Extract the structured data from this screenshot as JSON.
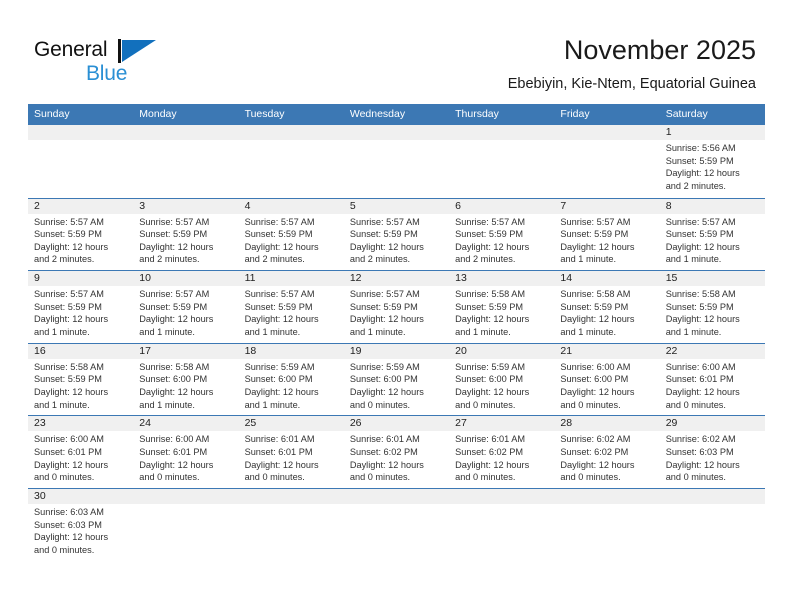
{
  "brand": {
    "name_top": "General",
    "name_bottom": "Blue",
    "primary_color": "#2a8fd4",
    "triangle_color": "#1270bd"
  },
  "header": {
    "title": "November 2025",
    "subtitle": "Ebebiyin, Kie-Ntem, Equatorial Guinea"
  },
  "theme": {
    "header_bar_color": "#3c78b4",
    "date_band_color": "#f0f0f0",
    "row_divider_color": "#3c78b4"
  },
  "calendar": {
    "weekdays": [
      "Sunday",
      "Monday",
      "Tuesday",
      "Wednesday",
      "Thursday",
      "Friday",
      "Saturday"
    ],
    "weeks": [
      [
        {
          "day": "",
          "lines": [
            "",
            "",
            "",
            ""
          ]
        },
        {
          "day": "",
          "lines": [
            "",
            "",
            "",
            ""
          ]
        },
        {
          "day": "",
          "lines": [
            "",
            "",
            "",
            ""
          ]
        },
        {
          "day": "",
          "lines": [
            "",
            "",
            "",
            ""
          ]
        },
        {
          "day": "",
          "lines": [
            "",
            "",
            "",
            ""
          ]
        },
        {
          "day": "",
          "lines": [
            "",
            "",
            "",
            ""
          ]
        },
        {
          "day": "1",
          "lines": [
            "Sunrise: 5:56 AM",
            "Sunset: 5:59 PM",
            "Daylight: 12 hours",
            "and 2 minutes."
          ]
        }
      ],
      [
        {
          "day": "2",
          "lines": [
            "Sunrise: 5:57 AM",
            "Sunset: 5:59 PM",
            "Daylight: 12 hours",
            "and 2 minutes."
          ]
        },
        {
          "day": "3",
          "lines": [
            "Sunrise: 5:57 AM",
            "Sunset: 5:59 PM",
            "Daylight: 12 hours",
            "and 2 minutes."
          ]
        },
        {
          "day": "4",
          "lines": [
            "Sunrise: 5:57 AM",
            "Sunset: 5:59 PM",
            "Daylight: 12 hours",
            "and 2 minutes."
          ]
        },
        {
          "day": "5",
          "lines": [
            "Sunrise: 5:57 AM",
            "Sunset: 5:59 PM",
            "Daylight: 12 hours",
            "and 2 minutes."
          ]
        },
        {
          "day": "6",
          "lines": [
            "Sunrise: 5:57 AM",
            "Sunset: 5:59 PM",
            "Daylight: 12 hours",
            "and 2 minutes."
          ]
        },
        {
          "day": "7",
          "lines": [
            "Sunrise: 5:57 AM",
            "Sunset: 5:59 PM",
            "Daylight: 12 hours",
            "and 1 minute."
          ]
        },
        {
          "day": "8",
          "lines": [
            "Sunrise: 5:57 AM",
            "Sunset: 5:59 PM",
            "Daylight: 12 hours",
            "and 1 minute."
          ]
        }
      ],
      [
        {
          "day": "9",
          "lines": [
            "Sunrise: 5:57 AM",
            "Sunset: 5:59 PM",
            "Daylight: 12 hours",
            "and 1 minute."
          ]
        },
        {
          "day": "10",
          "lines": [
            "Sunrise: 5:57 AM",
            "Sunset: 5:59 PM",
            "Daylight: 12 hours",
            "and 1 minute."
          ]
        },
        {
          "day": "11",
          "lines": [
            "Sunrise: 5:57 AM",
            "Sunset: 5:59 PM",
            "Daylight: 12 hours",
            "and 1 minute."
          ]
        },
        {
          "day": "12",
          "lines": [
            "Sunrise: 5:57 AM",
            "Sunset: 5:59 PM",
            "Daylight: 12 hours",
            "and 1 minute."
          ]
        },
        {
          "day": "13",
          "lines": [
            "Sunrise: 5:58 AM",
            "Sunset: 5:59 PM",
            "Daylight: 12 hours",
            "and 1 minute."
          ]
        },
        {
          "day": "14",
          "lines": [
            "Sunrise: 5:58 AM",
            "Sunset: 5:59 PM",
            "Daylight: 12 hours",
            "and 1 minute."
          ]
        },
        {
          "day": "15",
          "lines": [
            "Sunrise: 5:58 AM",
            "Sunset: 5:59 PM",
            "Daylight: 12 hours",
            "and 1 minute."
          ]
        }
      ],
      [
        {
          "day": "16",
          "lines": [
            "Sunrise: 5:58 AM",
            "Sunset: 5:59 PM",
            "Daylight: 12 hours",
            "and 1 minute."
          ]
        },
        {
          "day": "17",
          "lines": [
            "Sunrise: 5:58 AM",
            "Sunset: 6:00 PM",
            "Daylight: 12 hours",
            "and 1 minute."
          ]
        },
        {
          "day": "18",
          "lines": [
            "Sunrise: 5:59 AM",
            "Sunset: 6:00 PM",
            "Daylight: 12 hours",
            "and 1 minute."
          ]
        },
        {
          "day": "19",
          "lines": [
            "Sunrise: 5:59 AM",
            "Sunset: 6:00 PM",
            "Daylight: 12 hours",
            "and 0 minutes."
          ]
        },
        {
          "day": "20",
          "lines": [
            "Sunrise: 5:59 AM",
            "Sunset: 6:00 PM",
            "Daylight: 12 hours",
            "and 0 minutes."
          ]
        },
        {
          "day": "21",
          "lines": [
            "Sunrise: 6:00 AM",
            "Sunset: 6:00 PM",
            "Daylight: 12 hours",
            "and 0 minutes."
          ]
        },
        {
          "day": "22",
          "lines": [
            "Sunrise: 6:00 AM",
            "Sunset: 6:01 PM",
            "Daylight: 12 hours",
            "and 0 minutes."
          ]
        }
      ],
      [
        {
          "day": "23",
          "lines": [
            "Sunrise: 6:00 AM",
            "Sunset: 6:01 PM",
            "Daylight: 12 hours",
            "and 0 minutes."
          ]
        },
        {
          "day": "24",
          "lines": [
            "Sunrise: 6:00 AM",
            "Sunset: 6:01 PM",
            "Daylight: 12 hours",
            "and 0 minutes."
          ]
        },
        {
          "day": "25",
          "lines": [
            "Sunrise: 6:01 AM",
            "Sunset: 6:01 PM",
            "Daylight: 12 hours",
            "and 0 minutes."
          ]
        },
        {
          "day": "26",
          "lines": [
            "Sunrise: 6:01 AM",
            "Sunset: 6:02 PM",
            "Daylight: 12 hours",
            "and 0 minutes."
          ]
        },
        {
          "day": "27",
          "lines": [
            "Sunrise: 6:01 AM",
            "Sunset: 6:02 PM",
            "Daylight: 12 hours",
            "and 0 minutes."
          ]
        },
        {
          "day": "28",
          "lines": [
            "Sunrise: 6:02 AM",
            "Sunset: 6:02 PM",
            "Daylight: 12 hours",
            "and 0 minutes."
          ]
        },
        {
          "day": "29",
          "lines": [
            "Sunrise: 6:02 AM",
            "Sunset: 6:03 PM",
            "Daylight: 12 hours",
            "and 0 minutes."
          ]
        }
      ],
      [
        {
          "day": "30",
          "lines": [
            "Sunrise: 6:03 AM",
            "Sunset: 6:03 PM",
            "Daylight: 12 hours",
            "and 0 minutes."
          ]
        },
        {
          "day": "",
          "lines": [
            "",
            "",
            "",
            ""
          ]
        },
        {
          "day": "",
          "lines": [
            "",
            "",
            "",
            ""
          ]
        },
        {
          "day": "",
          "lines": [
            "",
            "",
            "",
            ""
          ]
        },
        {
          "day": "",
          "lines": [
            "",
            "",
            "",
            ""
          ]
        },
        {
          "day": "",
          "lines": [
            "",
            "",
            "",
            ""
          ]
        },
        {
          "day": "",
          "lines": [
            "",
            "",
            "",
            ""
          ]
        }
      ]
    ]
  }
}
